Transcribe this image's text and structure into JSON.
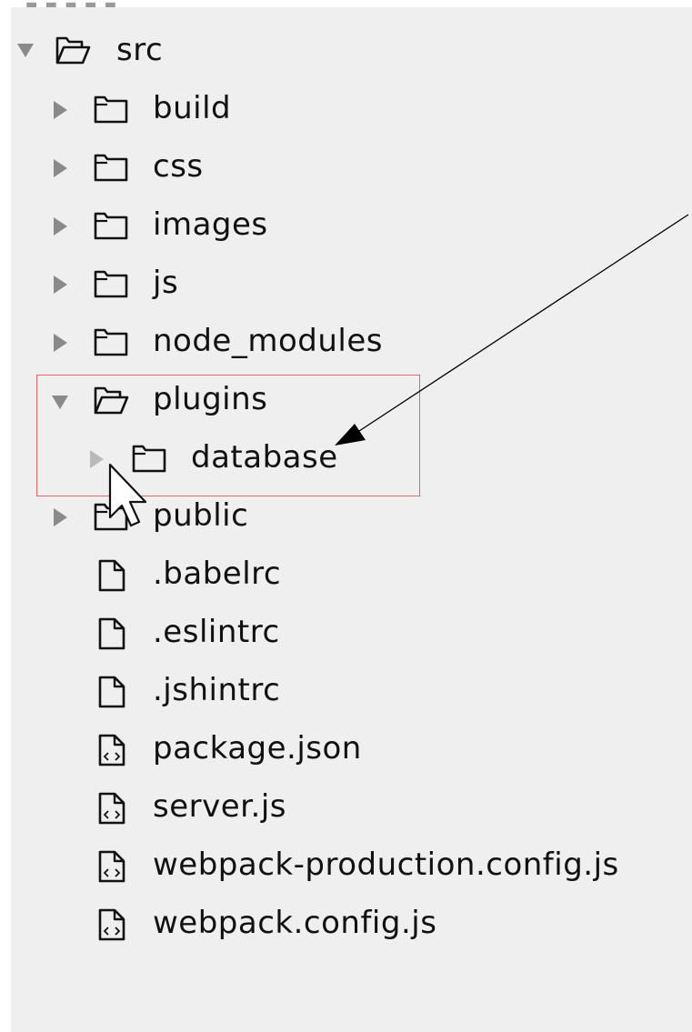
{
  "tree": {
    "root": {
      "label": "src",
      "state": "expanded"
    },
    "folders": [
      {
        "label": "build",
        "state": "collapsed"
      },
      {
        "label": "css",
        "state": "collapsed"
      },
      {
        "label": "images",
        "state": "collapsed"
      },
      {
        "label": "js",
        "state": "collapsed"
      },
      {
        "label": "node_modules",
        "state": "collapsed"
      },
      {
        "label": "plugins",
        "state": "expanded"
      },
      {
        "label": "database",
        "state": "collapsed"
      },
      {
        "label": "public",
        "state": "collapsed"
      }
    ],
    "files": [
      {
        "label": ".babelrc",
        "icon": "file-icon"
      },
      {
        "label": ".eslintrc",
        "icon": "file-icon"
      },
      {
        "label": ".jshintrc",
        "icon": "file-icon"
      },
      {
        "label": "package.json",
        "icon": "code-file-icon"
      },
      {
        "label": "server.js",
        "icon": "code-file-icon"
      },
      {
        "label": "webpack-production.config.js",
        "icon": "code-file-icon"
      },
      {
        "label": "webpack.config.js",
        "icon": "code-file-icon"
      }
    ]
  },
  "annotation": {
    "highlight_color": "#e9646a",
    "arrow_color": "#000000"
  },
  "colors": {
    "panel_background": "#efefef",
    "expander": "#8a8a8a",
    "text": "#111111"
  }
}
